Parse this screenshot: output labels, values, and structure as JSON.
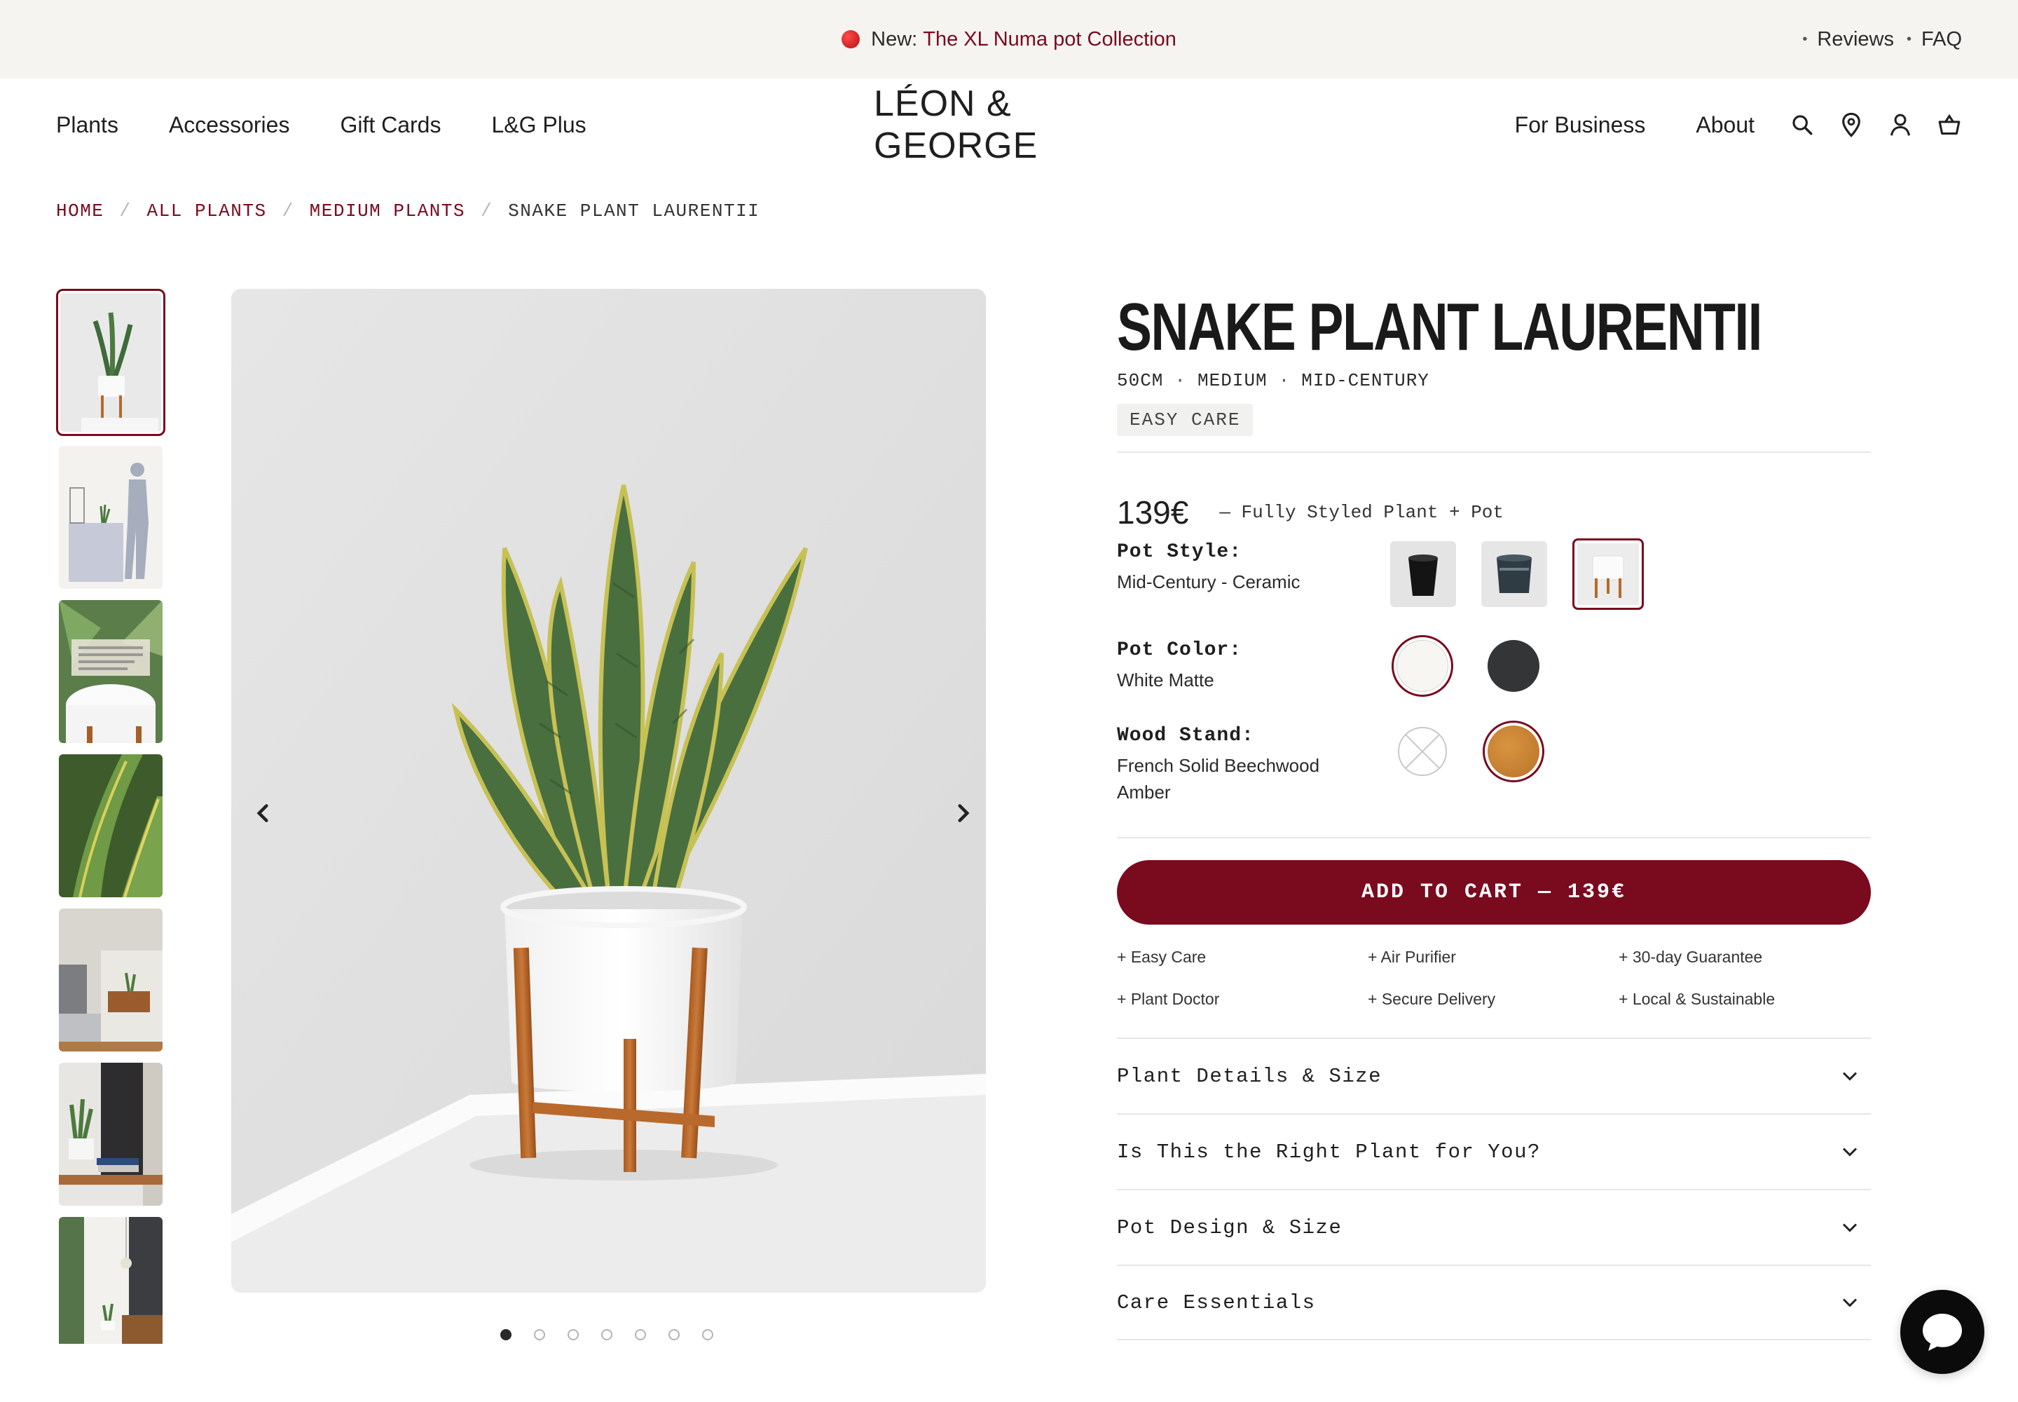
{
  "announcement": {
    "prefix": "New:",
    "link": "The XL Numa pot Collection",
    "right_links": [
      "Reviews",
      "FAQ"
    ],
    "dot_color": "#d4161a"
  },
  "header": {
    "nav_left": [
      "Plants",
      "Accessories",
      "Gift Cards",
      "L&G Plus"
    ],
    "logo": "LÉON & GEORGE",
    "nav_right": [
      "For Business",
      "About"
    ],
    "icons": [
      "search-icon",
      "location-pin-icon",
      "account-icon",
      "cart-basket-icon"
    ]
  },
  "breadcrumb": {
    "items": [
      "HOME",
      "ALL PLANTS",
      "MEDIUM PLANTS",
      "SNAKE PLANT LAURENTII"
    ],
    "separator": "/"
  },
  "gallery": {
    "thumbnail_count": 7,
    "selected_index": 0,
    "image_count": 7,
    "active_dot": 0,
    "prev_icon": "chevron-left-icon",
    "next_icon": "chevron-right-icon"
  },
  "product": {
    "title": "SNAKE PLANT LAURENTII",
    "meta": [
      "50CM",
      "MEDIUM",
      "MID-CENTURY"
    ],
    "meta_separator": "·",
    "badge": "EASY CARE",
    "price": "139€",
    "price_note": "— Fully Styled Plant + Pot",
    "options": {
      "pot_style": {
        "label": "Pot Style:",
        "value": "Mid-Century - Ceramic",
        "selected_index": 2,
        "swatch_count": 3
      },
      "pot_color": {
        "label": "Pot Color:",
        "value": "White Matte",
        "selected_index": 0,
        "colors": [
          "#f7f6f2",
          "#333537"
        ]
      },
      "wood_stand": {
        "label": "Wood Stand:",
        "value": "French Solid Beechwood Amber",
        "selected_index": 1,
        "colors": [
          "none",
          "#c98534"
        ]
      }
    },
    "add_to_cart": "ADD TO CART — 139€",
    "benefits": [
      "+ Easy Care",
      "+ Air Purifier",
      "+ 30-day Guarantee",
      "+ Plant Doctor",
      "+ Secure Delivery",
      "+ Local & Sustainable"
    ],
    "accordion": [
      "Plant Details & Size",
      "Is This the Right Plant for You?",
      "Pot Design & Size",
      "Care Essentials"
    ]
  },
  "colors": {
    "brand": "#7a0a1e",
    "announcement_bg": "#f5f4f1",
    "text": "#1f1f1f"
  },
  "chat": {
    "icon": "chat-bubble-icon"
  }
}
